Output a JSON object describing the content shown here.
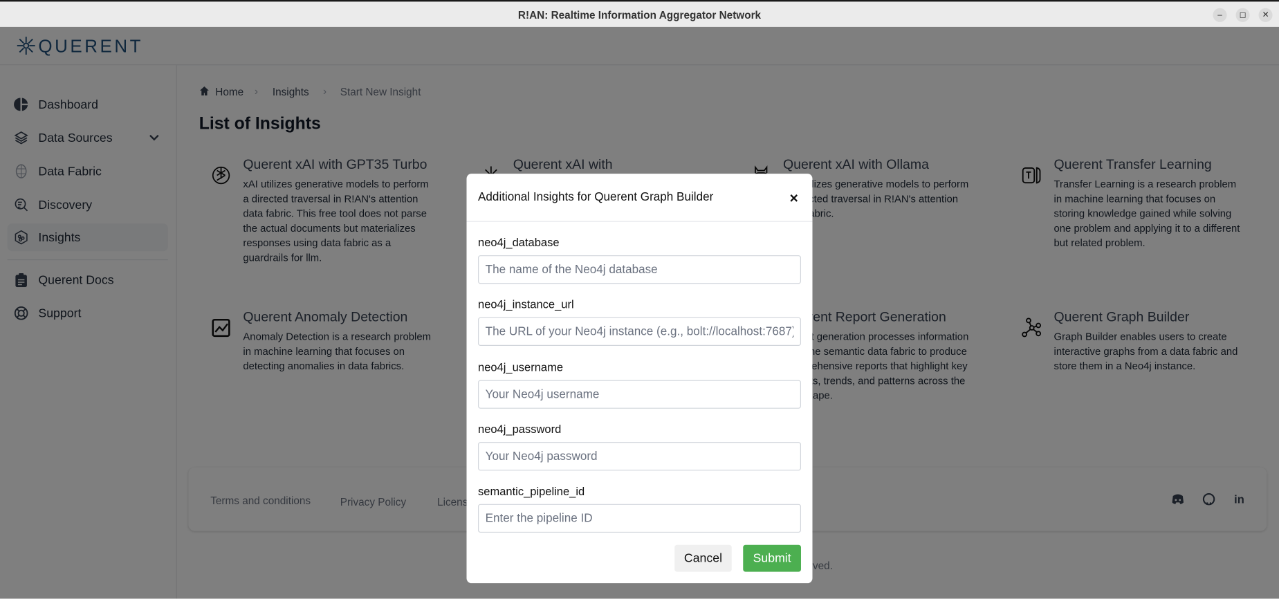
{
  "window": {
    "title": "R!AN: Realtime Information Aggregator Network",
    "controls": [
      "minimize",
      "restore",
      "close"
    ]
  },
  "header": {
    "logo_text": "QUERENT",
    "brand_color": "#1e4e7a"
  },
  "sidebar": {
    "items": [
      {
        "label": "Dashboard",
        "icon": "pie-chart-icon"
      },
      {
        "label": "Data Sources",
        "icon": "layers-icon",
        "expandable": true
      },
      {
        "label": "Data Fabric",
        "icon": "brain-icon"
      },
      {
        "label": "Discovery",
        "icon": "search-list-icon"
      },
      {
        "label": "Insights",
        "icon": "insights-icon",
        "active": true
      },
      {
        "label": "Querent Docs",
        "icon": "clipboard-icon"
      },
      {
        "label": "Support",
        "icon": "lifebuoy-icon"
      }
    ]
  },
  "breadcrumb": [
    "Home",
    "Insights",
    "Start New Insight"
  ],
  "page_title": "List of Insights",
  "cards": [
    {
      "title": "Querent xAI with GPT35 Turbo",
      "icon": "openai-icon",
      "description": "xAI utilizes generative models to perform a directed traversal in R!AN's attention data fabric. This free tool does not parse the actual documents but materializes responses using data fabric as a guardrails for llm."
    },
    {
      "title": "Querent xAI with",
      "icon": "sparkle-icon",
      "description": ""
    },
    {
      "title": "Querent xAI with Ollama",
      "icon": "llama-icon",
      "description": "xAI utilizes generative models to perform a directed traversal in R!AN's attention data fabric."
    },
    {
      "title": "Querent Transfer Learning",
      "icon": "text-transfer-icon",
      "description": "Transfer Learning is a research problem in machine learning that focuses on storing knowledge gained while solving one problem and applying it to a different but related problem."
    },
    {
      "title": "Querent Anomaly Detection",
      "icon": "chart-line-icon",
      "description": "Anomaly Detection is a research problem in machine learning that focuses on detecting anomalies in data fabrics."
    },
    {
      "title": "Querent Report Generation",
      "icon": "report-icon",
      "description": "Report generation processes information from the semantic data fabric to produce comprehensive reports that highlight key insights, trends, and patterns across the landscape."
    },
    {
      "title": "Querent Graph Builder",
      "icon": "graph-icon",
      "description": "Graph Builder enables users to create interactive graphs from a data fabric and store them in a Neo4j instance."
    }
  ],
  "footer": {
    "links": [
      "Terms and conditions",
      "Privacy Policy",
      "License"
    ],
    "social": [
      "discord-icon",
      "github-icon",
      "linkedin-icon"
    ],
    "copyright": "All rights reserved."
  },
  "modal": {
    "title": "Additional Insights for Querent Graph Builder",
    "close": "×",
    "fields": [
      {
        "label": "neo4j_database",
        "placeholder": "The name of the Neo4j database",
        "value": ""
      },
      {
        "label": "neo4j_instance_url",
        "placeholder": "The URL of your Neo4j instance (e.g., bolt://localhost:7687)",
        "value": ""
      },
      {
        "label": "neo4j_username",
        "placeholder": "Your Neo4j username",
        "value": ""
      },
      {
        "label": "neo4j_password",
        "placeholder": "Your Neo4j password",
        "value": ""
      },
      {
        "label": "semantic_pipeline_id",
        "placeholder": "Enter the pipeline ID",
        "value": ""
      }
    ],
    "cancel_label": "Cancel",
    "submit_label": "Submit",
    "submit_color": "#4caf50"
  }
}
